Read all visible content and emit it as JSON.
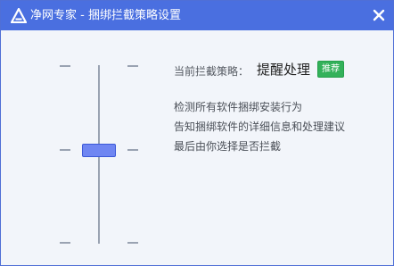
{
  "window": {
    "title": "净网专家 - 捆绑拦截策略设置"
  },
  "icons": {
    "app": "app-logo-icon",
    "close": "close-icon"
  },
  "colors": {
    "titlebar": "#4a6fe0",
    "background": "#f2f5fa",
    "slider_thumb": "#6f86f2",
    "badge": "#33b15a"
  },
  "policy_slider": {
    "levels": 3,
    "selected_level": 2
  },
  "status": {
    "label": "当前拦截策略：",
    "value": "提醒处理",
    "badge": "推荐"
  },
  "description": {
    "lines": [
      "检测所有软件捆绑安装行为",
      "告知捆绑软件的详细信息和处理建议",
      "最后由你选择是否拦截"
    ]
  }
}
